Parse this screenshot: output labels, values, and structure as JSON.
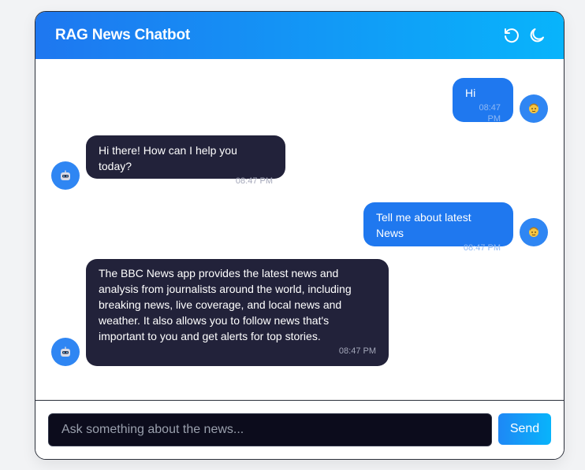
{
  "header": {
    "title": "RAG News Chatbot",
    "refresh_icon": "refresh-icon",
    "theme_icon": "moon-icon"
  },
  "messages": [
    {
      "sender": "user",
      "text": "Hi",
      "time": "08:47 PM",
      "avatar_icon": "user-face-icon"
    },
    {
      "sender": "bot",
      "text": "Hi there! How can I help you today?",
      "time": "08:47 PM",
      "avatar_icon": "robot-icon"
    },
    {
      "sender": "user",
      "text": "Tell me about latest News",
      "time": "08:47 PM",
      "avatar_icon": "user-face-icon"
    },
    {
      "sender": "bot",
      "text": "The BBC News app provides the latest news and analysis from journalists around the world, including breaking news, live coverage, and local news and weather. It also allows you to follow news that's important to you and get alerts for top stories.",
      "time": "08:47 PM",
      "avatar_icon": "robot-icon"
    }
  ],
  "composer": {
    "placeholder": "Ask something about the news...",
    "value": "",
    "send_label": "Send"
  },
  "colors": {
    "header_gradient_start": "#1e77f0",
    "header_gradient_end": "#08b4fb",
    "user_bubble": "#1f78ef",
    "bot_bubble": "#22223a",
    "avatar": "#2f86f3",
    "input_background": "#0c0c1c"
  }
}
